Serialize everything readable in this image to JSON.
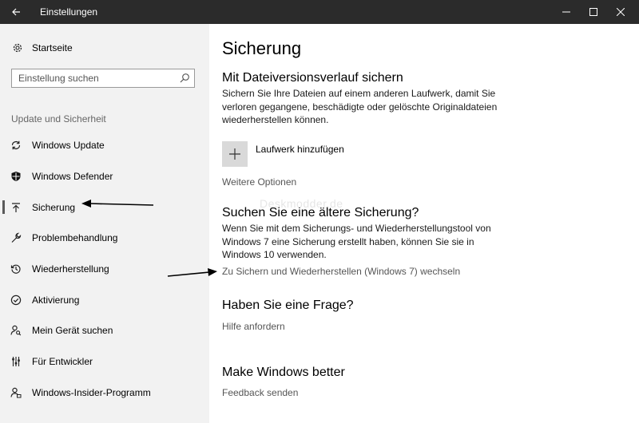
{
  "window": {
    "title": "Einstellungen",
    "controls": [
      "back-icon",
      "minimize-icon",
      "maximize-icon",
      "close-icon"
    ]
  },
  "sidebar": {
    "home_label": "Startseite",
    "search_placeholder": "Einstellung suchen",
    "section_title": "Update und Sicherheit",
    "items": [
      {
        "label": "Windows Update",
        "icon": "sync-icon"
      },
      {
        "label": "Windows Defender",
        "icon": "shield-icon"
      },
      {
        "label": "Sicherung",
        "icon": "upload-arrow-icon",
        "selected": true
      },
      {
        "label": "Problembehandlung",
        "icon": "wrench-icon"
      },
      {
        "label": "Wiederherstellung",
        "icon": "history-icon"
      },
      {
        "label": "Aktivierung",
        "icon": "check-circle-icon"
      },
      {
        "label": "Mein Gerät suchen",
        "icon": "person-search-icon"
      },
      {
        "label": "Für Entwickler",
        "icon": "developer-sliders-icon"
      },
      {
        "label": "Windows-Insider-Programm",
        "icon": "insider-icon"
      }
    ]
  },
  "main": {
    "title": "Sicherung",
    "file_history": {
      "heading": "Mit Dateiversionsverlauf sichern",
      "description": "Sichern Sie Ihre Dateien auf einem anderen Laufwerk, damit Sie verloren gegangene, beschädigte oder gelöschte Originaldateien wiederherstellen können.",
      "add_drive_label": "Laufwerk hinzufügen",
      "more_options_link": "Weitere Optionen"
    },
    "older_backup": {
      "heading": "Suchen Sie eine ältere Sicherung?",
      "description": "Wenn Sie mit dem Sicherungs- und Wiederherstellungstool von Windows 7 eine Sicherung erstellt haben, können Sie sie in Windows 10 verwenden.",
      "link": "Zu Sichern und Wiederherstellen (Windows 7) wechseln"
    },
    "question": {
      "heading": "Haben Sie eine Frage?",
      "link": "Hilfe anfordern"
    },
    "feedback": {
      "heading": "Make Windows better",
      "link": "Feedback senden"
    }
  },
  "watermark": "Deskmodder.de",
  "colors": {
    "titlebar": "#2b2b2b",
    "sidebar": "#f2f2f2",
    "content": "#ffffff",
    "link": "#555555"
  }
}
